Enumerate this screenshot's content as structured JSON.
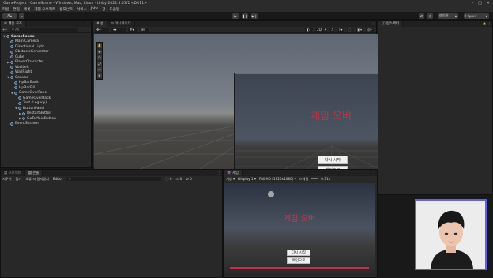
{
  "title": "GameProject - GameScene - Windows, Mac, Linux - Unity 2022.3.53f1 <DX11>",
  "menu": [
    "파일",
    "편집",
    "에셋",
    "게임 오브젝트",
    "컴포넌트",
    "서비스",
    "Jobs",
    "창",
    "도움말"
  ],
  "toolbar": {
    "account": "계",
    "layers": "레이어",
    "layout": "Layout",
    "tools_label": "✦"
  },
  "hierarchy": {
    "tab": "계층 구조",
    "search": "All",
    "items": [
      {
        "label": "GameScene",
        "depth": 0,
        "bold": true,
        "arrow": "▼"
      },
      {
        "label": "Main Camera",
        "depth": 1
      },
      {
        "label": "Directional Light",
        "depth": 1
      },
      {
        "label": "ObstacleGenerator",
        "depth": 1
      },
      {
        "label": "Cube",
        "depth": 1
      },
      {
        "label": "PlayerCharacter",
        "depth": 1,
        "arrow": "▶"
      },
      {
        "label": "WallLeft",
        "depth": 1
      },
      {
        "label": "WallRight",
        "depth": 1
      },
      {
        "label": "Canvas",
        "depth": 1,
        "arrow": "▼"
      },
      {
        "label": "HpBarBack",
        "depth": 2
      },
      {
        "label": "HpBarFill",
        "depth": 2
      },
      {
        "label": "GameOverPanel",
        "depth": 2,
        "arrow": "▼"
      },
      {
        "label": "GameOverBack",
        "depth": 3
      },
      {
        "label": "Text (Legacy)",
        "depth": 3
      },
      {
        "label": "ButtonPanel",
        "depth": 3,
        "arrow": "▼"
      },
      {
        "label": "RestartButton",
        "depth": 4,
        "arrow": "▶"
      },
      {
        "label": "GoToMainButton",
        "depth": 4,
        "arrow": "▶"
      },
      {
        "label": "EventSystem",
        "depth": 1
      }
    ]
  },
  "scene": {
    "tab_scene": "씬",
    "tab_animator": "애니메이터",
    "persp": "< Persp",
    "gameover_text": "게임 오버",
    "restart_label": "다시 시작",
    "main_label": "메인으로"
  },
  "inspector": {
    "tab": "인스펙터"
  },
  "project": {
    "tab_project": "프로젝트",
    "tab_console": "콘솔",
    "console_items": [
      "지우기",
      "접기",
      "오류 시 일시정지",
      "Editor"
    ],
    "counts": [
      "0",
      "0",
      "0"
    ]
  },
  "game": {
    "tab": "게임",
    "mode": "게임",
    "display": "Display 1",
    "resolution": "Full HD (1920x1080)",
    "scale_label": "스케일",
    "scale_value": "0.31x",
    "gameover_text": "게임 오버",
    "restart_label": "다시 시작",
    "main_label": "메인으로"
  }
}
